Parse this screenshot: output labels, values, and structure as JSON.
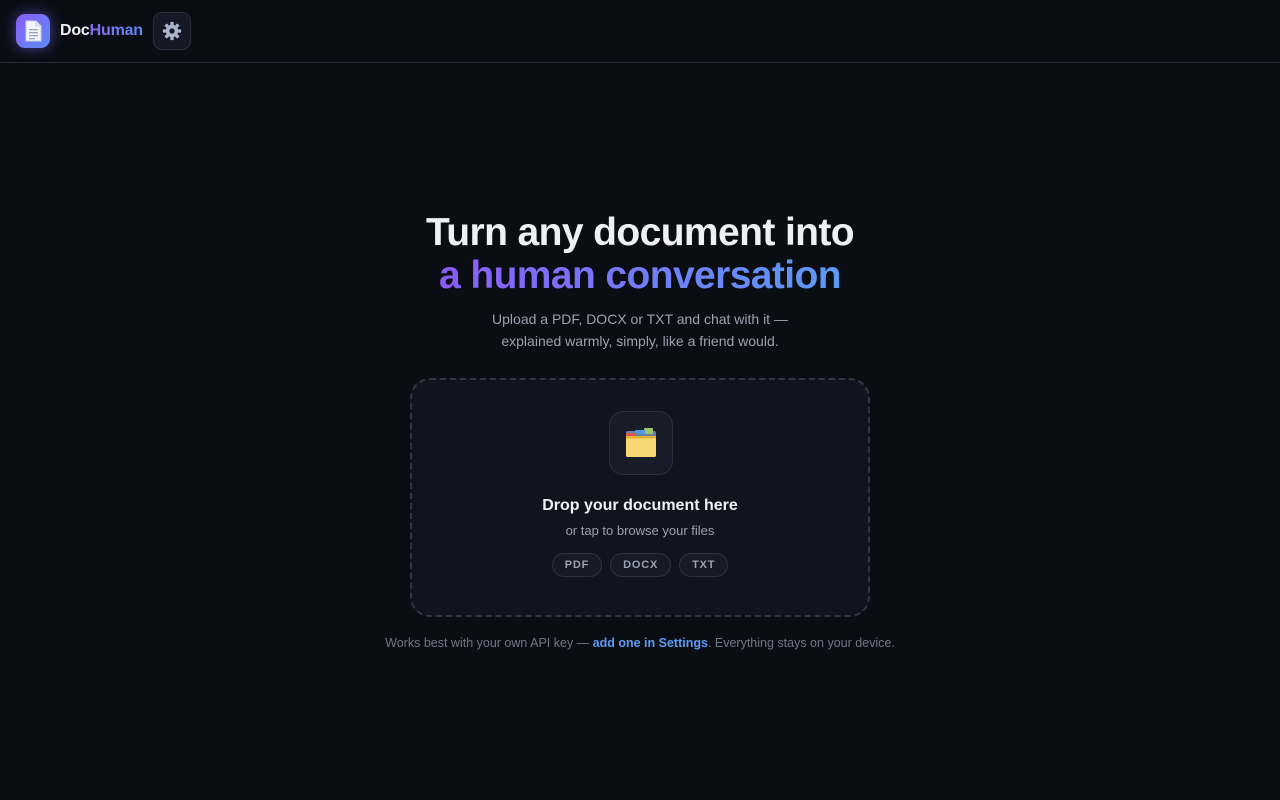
{
  "header": {
    "brand_part1": "Doc",
    "brand_part2": "Human",
    "logo_icon": "document-icon",
    "settings_icon": "gear-icon"
  },
  "hero": {
    "title_line1": "Turn any document into",
    "title_line2": "a human conversation",
    "subtitle_line1": "Upload a PDF, DOCX or TXT and chat with it —",
    "subtitle_line2": "explained warmly, simply, like a friend would."
  },
  "dropzone": {
    "icon": "folder-icon",
    "title": "Drop your document here",
    "subtitle": "or tap to browse your files",
    "formats": [
      "PDF",
      "DOCX",
      "TXT"
    ]
  },
  "footer": {
    "text_before": "Works best with your own API key — ",
    "link_text": "add one in Settings",
    "text_after": ". Everything stays on your device."
  },
  "colors": {
    "background": "#0a0d14",
    "accent_purple": "#8b5cf6",
    "accent_blue": "#5b9bf5"
  }
}
